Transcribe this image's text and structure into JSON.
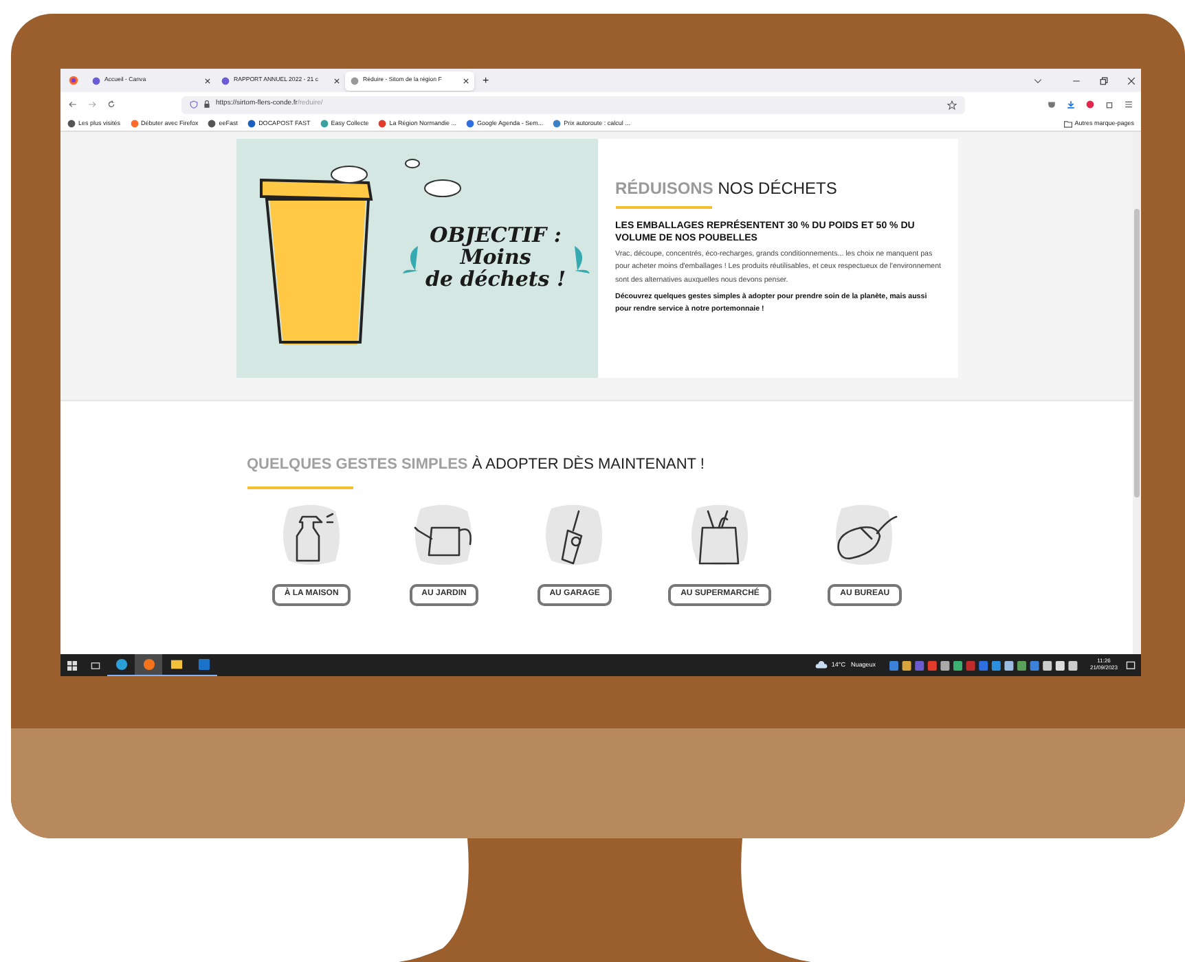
{
  "browser": {
    "tabs": [
      {
        "title": "Accueil - Canva",
        "selected": false
      },
      {
        "title": "RAPPORT ANNUEL 2022 - 21 c",
        "selected": false
      },
      {
        "title": "Réduire - Sitom de la région F",
        "selected": true
      }
    ],
    "new_tab": "+",
    "url": {
      "host": "https://sirtom-flers-conde.fr",
      "path": "/reduire/"
    },
    "bookmarks": [
      "Les plus visités",
      "Débuter avec Firefox",
      "eeFast",
      "DOCAPOST FAST",
      "Easy Collecte",
      "La Région Normandie ...",
      "Google Agenda - Sem...",
      "Prix autoroute : calcul ..."
    ],
    "other_bookmarks": "Autres marque-pages"
  },
  "hero": {
    "illustration_text": [
      "OBJECTIF :",
      "Moins",
      "de déchets !"
    ],
    "title_light": "RÉDUISONS",
    "title_dark": "NOS DÉCHETS",
    "subtitle": "LES EMBALLAGES REPRÉSENTENT 30 % DU POIDS ET 50 % DU VOLUME DE NOS POUBELLES",
    "body": "Vrac, découpe, concentrés, éco-recharges, grands conditionnements... les choix ne manquent pas pour acheter moins d'emballages ! Les produits réutilisables, et ceux respectueux de l'environnement sont des alternatives auxquelles nous devons penser.",
    "callout": "Découvrez quelques gestes simples à adopter pour prendre soin de la planète, mais aussi pour rendre service à notre portemonnaie !"
  },
  "gestures": {
    "title_light": "QUELQUES GESTES SIMPLES",
    "title_dark": "À ADOPTER DÈS MAINTENANT !",
    "items": [
      {
        "kind": "spray",
        "label": "À LA MAISON"
      },
      {
        "kind": "watering_can",
        "label": "AU JARDIN"
      },
      {
        "kind": "drill",
        "label": "AU GARAGE"
      },
      {
        "kind": "bag",
        "label": "AU SUPERMARCHÉ"
      },
      {
        "kind": "mouse",
        "label": "AU BUREAU"
      }
    ]
  },
  "taskbar": {
    "apps": [
      {
        "kind": "edge",
        "selected": false
      },
      {
        "kind": "firefox",
        "selected": true
      },
      {
        "kind": "folder",
        "selected": false
      },
      {
        "kind": "outlook",
        "selected": false
      }
    ],
    "weather": {
      "temperature": "14°C",
      "condition": "Nuageux"
    },
    "time": "11:26",
    "date": "21/09/2023"
  }
}
